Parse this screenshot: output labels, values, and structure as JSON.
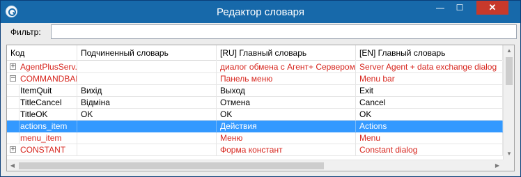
{
  "window": {
    "title": "Редактор словаря"
  },
  "titlebar": {
    "minimize": "—",
    "maximize": "☐",
    "close": "✕"
  },
  "filter": {
    "label": "Фильтр:",
    "value": ""
  },
  "table": {
    "columns": [
      "Код",
      "Подчиненный словарь",
      "[RU] Главный словарь",
      "[EN] Главный словарь"
    ],
    "rows": [
      {
        "expander": "+",
        "code": "AgentPlusServ...",
        "sub": "",
        "ru": "диалог обмена с Агент+ Сервером",
        "en": "Server Agent + data exchange dialog",
        "red": true,
        "selected": false
      },
      {
        "expander": "−",
        "code": "COMMANDBAR",
        "sub": "",
        "ru": "Панель меню",
        "en": "Menu bar",
        "red": true,
        "selected": false
      },
      {
        "expander": "",
        "code": "ItemQuit",
        "sub": "Вихід",
        "ru": "Выход",
        "en": "Exit",
        "red": false,
        "selected": false
      },
      {
        "expander": "",
        "code": "TitleCancel",
        "sub": "Відміна",
        "ru": "Отмена",
        "en": "Cancel",
        "red": false,
        "selected": false
      },
      {
        "expander": "",
        "code": "TitleOK",
        "sub": "OK",
        "ru": "OK",
        "en": "OK",
        "red": false,
        "selected": false
      },
      {
        "expander": "",
        "code": "actions_item",
        "sub": "",
        "ru": "Действия",
        "en": "Actions",
        "red": false,
        "selected": true
      },
      {
        "expander": "",
        "code": "menu_item",
        "sub": "",
        "ru": "Меню",
        "en": "Menu",
        "red": true,
        "selected": false
      },
      {
        "expander": "+",
        "code": "CONSTANT",
        "sub": "",
        "ru": "Форма констант",
        "en": "Constant dialog",
        "red": true,
        "selected": false
      }
    ]
  },
  "scrollbars": {
    "up": "▲",
    "down": "▼",
    "left": "◀",
    "right": "▶"
  }
}
